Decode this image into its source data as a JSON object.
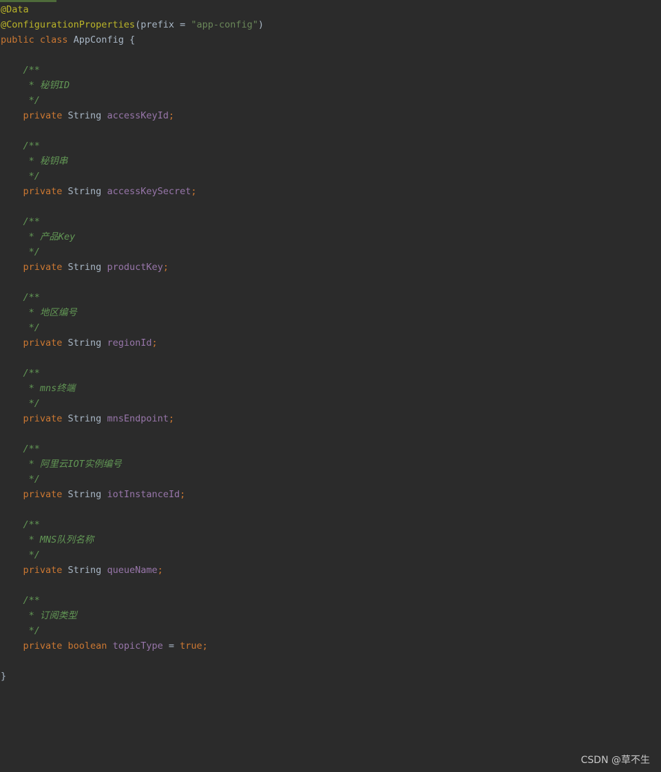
{
  "lines": [
    {
      "tokens": [
        {
          "text": "@Data",
          "cls": "annotation"
        }
      ]
    },
    {
      "tokens": [
        {
          "text": "@ConfigurationProperties",
          "cls": "annotation"
        },
        {
          "text": "(prefix = ",
          "cls": "plain"
        },
        {
          "text": "\"app-config\"",
          "cls": "string"
        },
        {
          "text": ")",
          "cls": "plain"
        }
      ]
    },
    {
      "tokens": [
        {
          "text": "public class ",
          "cls": "keyword"
        },
        {
          "text": "AppConfig {",
          "cls": "plain"
        }
      ]
    },
    {
      "tokens": []
    },
    {
      "tokens": [
        {
          "text": "    /**",
          "cls": "comment"
        }
      ]
    },
    {
      "tokens": [
        {
          "text": "     * 秘钥ID",
          "cls": "comment"
        }
      ]
    },
    {
      "tokens": [
        {
          "text": "     */",
          "cls": "comment"
        }
      ]
    },
    {
      "tokens": [
        {
          "text": "    private ",
          "cls": "keyword"
        },
        {
          "text": "String ",
          "cls": "plain"
        },
        {
          "text": "accessKeyId",
          "cls": "field"
        },
        {
          "text": ";",
          "cls": "semicolon"
        }
      ]
    },
    {
      "tokens": []
    },
    {
      "tokens": [
        {
          "text": "    /**",
          "cls": "comment"
        }
      ]
    },
    {
      "tokens": [
        {
          "text": "     * 秘钥串",
          "cls": "comment"
        }
      ]
    },
    {
      "tokens": [
        {
          "text": "     */",
          "cls": "comment"
        }
      ]
    },
    {
      "tokens": [
        {
          "text": "    private ",
          "cls": "keyword"
        },
        {
          "text": "String ",
          "cls": "plain"
        },
        {
          "text": "accessKeySecret",
          "cls": "field"
        },
        {
          "text": ";",
          "cls": "semicolon"
        }
      ]
    },
    {
      "tokens": []
    },
    {
      "tokens": [
        {
          "text": "    /**",
          "cls": "comment"
        }
      ]
    },
    {
      "tokens": [
        {
          "text": "     * 产品Key",
          "cls": "comment"
        }
      ]
    },
    {
      "tokens": [
        {
          "text": "     */",
          "cls": "comment"
        }
      ]
    },
    {
      "tokens": [
        {
          "text": "    private ",
          "cls": "keyword"
        },
        {
          "text": "String ",
          "cls": "plain"
        },
        {
          "text": "productKey",
          "cls": "field"
        },
        {
          "text": ";",
          "cls": "semicolon"
        }
      ]
    },
    {
      "tokens": []
    },
    {
      "tokens": [
        {
          "text": "    /**",
          "cls": "comment"
        }
      ]
    },
    {
      "tokens": [
        {
          "text": "     * 地区编号",
          "cls": "comment"
        }
      ]
    },
    {
      "tokens": [
        {
          "text": "     */",
          "cls": "comment"
        }
      ]
    },
    {
      "tokens": [
        {
          "text": "    private ",
          "cls": "keyword"
        },
        {
          "text": "String ",
          "cls": "plain"
        },
        {
          "text": "regionId",
          "cls": "field"
        },
        {
          "text": ";",
          "cls": "semicolon"
        }
      ]
    },
    {
      "tokens": []
    },
    {
      "tokens": [
        {
          "text": "    /**",
          "cls": "comment"
        }
      ]
    },
    {
      "tokens": [
        {
          "text": "     * mns终端",
          "cls": "comment"
        }
      ]
    },
    {
      "tokens": [
        {
          "text": "     */",
          "cls": "comment"
        }
      ]
    },
    {
      "tokens": [
        {
          "text": "    private ",
          "cls": "keyword"
        },
        {
          "text": "String ",
          "cls": "plain"
        },
        {
          "text": "mnsEndpoint",
          "cls": "field"
        },
        {
          "text": ";",
          "cls": "semicolon"
        }
      ]
    },
    {
      "tokens": []
    },
    {
      "tokens": [
        {
          "text": "    /**",
          "cls": "comment"
        }
      ]
    },
    {
      "tokens": [
        {
          "text": "     * 阿里云IOT实例编号",
          "cls": "comment"
        }
      ]
    },
    {
      "tokens": [
        {
          "text": "     */",
          "cls": "comment"
        }
      ]
    },
    {
      "tokens": [
        {
          "text": "    private ",
          "cls": "keyword"
        },
        {
          "text": "String ",
          "cls": "plain"
        },
        {
          "text": "iotInstanceId",
          "cls": "field"
        },
        {
          "text": ";",
          "cls": "semicolon"
        }
      ]
    },
    {
      "tokens": []
    },
    {
      "tokens": [
        {
          "text": "    /**",
          "cls": "comment"
        }
      ]
    },
    {
      "tokens": [
        {
          "text": "     * MNS队列名称",
          "cls": "comment"
        }
      ]
    },
    {
      "tokens": [
        {
          "text": "     */",
          "cls": "comment"
        }
      ]
    },
    {
      "tokens": [
        {
          "text": "    private ",
          "cls": "keyword"
        },
        {
          "text": "String ",
          "cls": "plain"
        },
        {
          "text": "queueName",
          "cls": "field"
        },
        {
          "text": ";",
          "cls": "semicolon"
        }
      ]
    },
    {
      "tokens": []
    },
    {
      "tokens": [
        {
          "text": "    /**",
          "cls": "comment"
        }
      ]
    },
    {
      "tokens": [
        {
          "text": "     * 订阅类型",
          "cls": "comment"
        }
      ]
    },
    {
      "tokens": [
        {
          "text": "     */",
          "cls": "comment"
        }
      ]
    },
    {
      "tokens": [
        {
          "text": "    private boolean ",
          "cls": "keyword"
        },
        {
          "text": "topicType",
          "cls": "field"
        },
        {
          "text": " = ",
          "cls": "plain"
        },
        {
          "text": "true",
          "cls": "keyword"
        },
        {
          "text": ";",
          "cls": "semicolon"
        }
      ]
    },
    {
      "tokens": []
    },
    {
      "tokens": [
        {
          "text": "}",
          "cls": "plain"
        }
      ]
    }
  ],
  "watermark": "CSDN @草不生",
  "colors": {
    "background": "#2b2b2b",
    "annotation": "#bbb529",
    "keyword": "#cc7832",
    "string": "#6a8759",
    "comment": "#629755",
    "field": "#9876aa",
    "plain": "#a9b7c6"
  }
}
